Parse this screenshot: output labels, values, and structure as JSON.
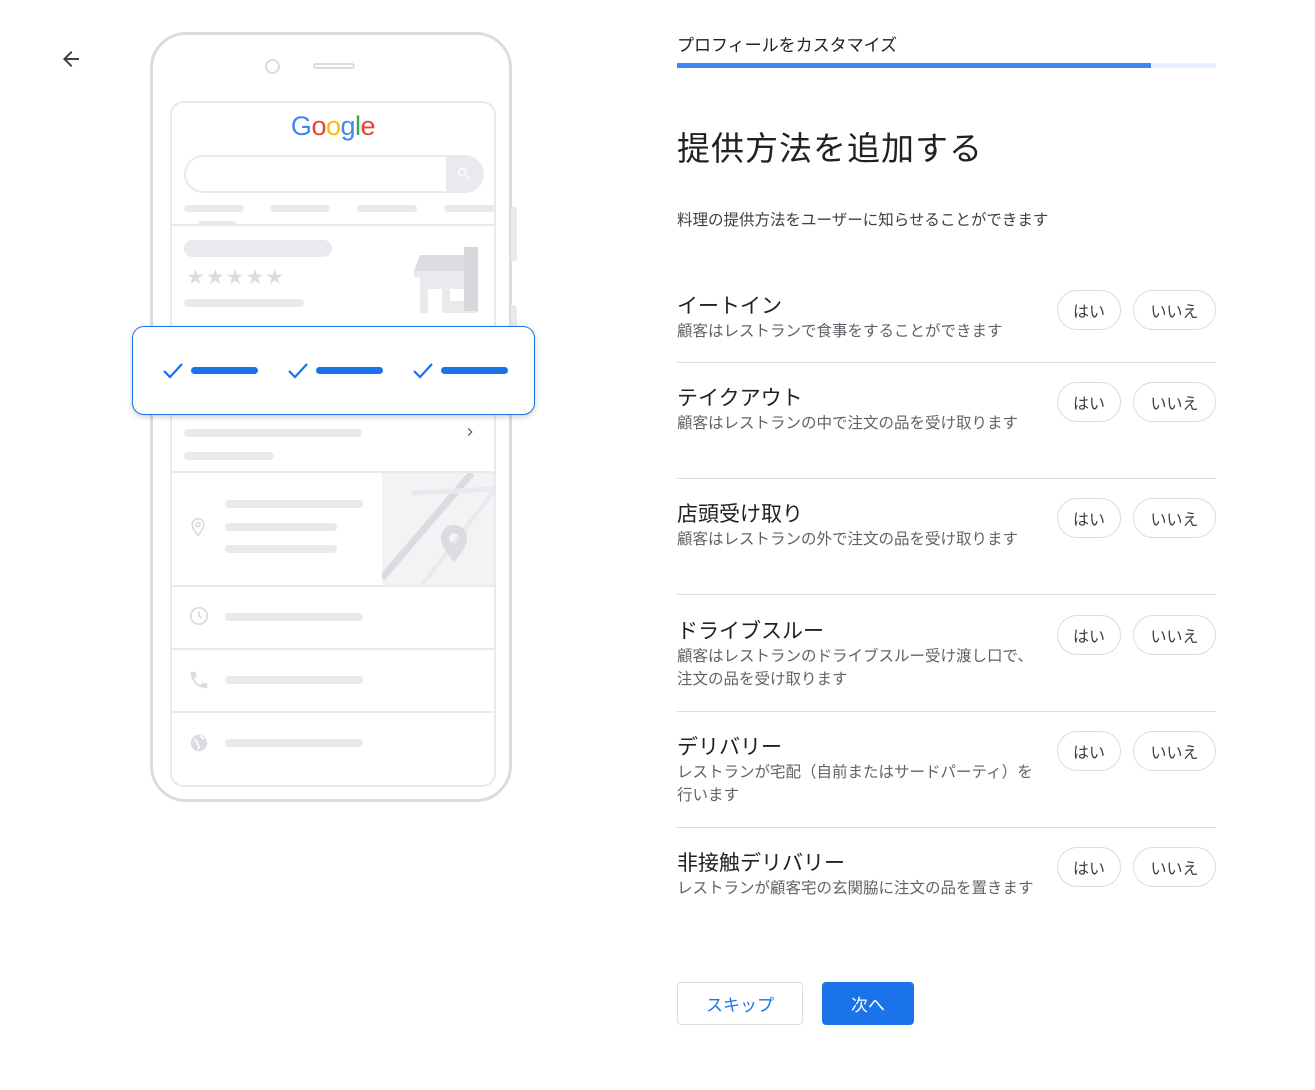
{
  "header": {
    "back_icon": "arrow-back-icon",
    "step_label": "プロフィールをカスタマイズ",
    "progress_percent": 88
  },
  "illustration": {
    "logo_letters": [
      {
        "char": "G",
        "color": "#4285f4"
      },
      {
        "char": "o",
        "color": "#ea4335"
      },
      {
        "char": "o",
        "color": "#fbbc05"
      },
      {
        "char": "g",
        "color": "#4285f4"
      },
      {
        "char": "l",
        "color": "#34a853"
      },
      {
        "char": "e",
        "color": "#ea4335"
      }
    ],
    "stars": "★★★★★",
    "accent_color": "#1a73e8"
  },
  "main": {
    "title": "提供方法を追加する",
    "description": "料理の提供方法をユーザーに知らせることができます",
    "yes_label": "はい",
    "no_label": "いいえ",
    "options": [
      {
        "name": "イートイン",
        "description": "顧客はレストランで食事をすることができます"
      },
      {
        "name": "テイクアウト",
        "description": "顧客はレストランの中で注文の品を受け取ります"
      },
      {
        "name": "店頭受け取り",
        "description": "顧客はレストランの外で注文の品を受け取ります"
      },
      {
        "name": "ドライブスルー",
        "description": "顧客はレストランのドライブスルー受け渡し口で、注文の品を受け取ります"
      },
      {
        "name": "デリバリー",
        "description": "レストランが宅配（自前またはサードパーティ）を行います"
      },
      {
        "name": "非接触デリバリー",
        "description": "レストランが顧客宅の玄関脇に注文の品を置きます"
      }
    ]
  },
  "footer": {
    "skip_label": "スキップ",
    "next_label": "次へ"
  }
}
